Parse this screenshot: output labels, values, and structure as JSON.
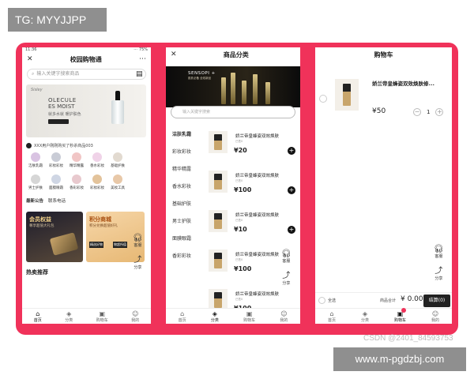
{
  "watermark_top": "TG: MYYJJPP",
  "watermark_bottom": "www.m-pgdzbj.com",
  "csdn_credit": "CSDN @2401_84593753",
  "colors": {
    "frame": "#f0325a",
    "dark": "#222222"
  },
  "screen1": {
    "status_time": "11:36",
    "status_right": "⋯ 75%",
    "title": "校园购物通",
    "close_icon": "close-icon",
    "more_icon": "more-icon",
    "search_placeholder": "输入关键字搜索商品",
    "banner": {
      "brand": "Sisley",
      "line1": "OLECULE",
      "line2": "ES MOIST",
      "line3": "就多水就 暖护肤色"
    },
    "notice": "XXX用户刚刚购买了秒杀商品003",
    "categories": [
      "洁肤乳霜",
      "彩妆彩妆",
      "精华精露",
      "香水彩妆",
      "基础护肤",
      "",
      "男士护肤",
      "面膜眼霜",
      "香彩彩妆",
      "彩妆彩妆",
      "美妆工具",
      ""
    ],
    "announce_label": "最新公告",
    "announce_text": "联系电话",
    "promo1_title": "会员权益",
    "promo1_sub": "尊享超值大礼包",
    "promo2_title": "积分商城",
    "promo2_sub": "积分兑换超值好礼",
    "promo2_tag1": "精选好物",
    "promo2_tag2": "物超所值",
    "hot_title": "热卖推荐",
    "float_service": "客服",
    "float_share": "分享",
    "tabs": [
      "首页",
      "分类",
      "购物车",
      "我的"
    ]
  },
  "screen2": {
    "title": "商品分类",
    "banner_title": "SENSOPI +",
    "banner_sub": "肌肤必备 全线新品",
    "search_placeholder": "输入关键字搜索",
    "side_items": [
      "洁肤乳霜",
      "彩妆彩妆",
      "精华精露",
      "香水彩妆",
      "基础护肤",
      "男士护肤",
      "面膜眼霜",
      "香彩彩妆"
    ],
    "products": [
      {
        "name": "娇兰帝皇蜂姿双效焕肤",
        "tag": "已售0",
        "price": "¥20"
      },
      {
        "name": "娇兰帝皇蜂姿双效焕肤",
        "tag": "已售0",
        "price": "¥100"
      },
      {
        "name": "娇兰帝皇蜂姿双效焕肤",
        "tag": "已售0",
        "price": "¥10"
      },
      {
        "name": "娇兰帝皇蜂姿双效焕肤",
        "tag": "已售0",
        "price": "¥100"
      },
      {
        "name": "娇兰帝皇蜂姿双效焕肤",
        "tag": "已售0",
        "price": "¥100"
      }
    ],
    "float_service": "客服",
    "float_share": "分享",
    "tabs": [
      "首页",
      "分类",
      "购物车",
      "我的"
    ]
  },
  "screen3": {
    "title": "购物车",
    "item_name": "娇兰帝皇蜂姿双效焕肤修...",
    "item_price": "¥50",
    "quantity": "1",
    "float_service": "客服",
    "float_share": "分享",
    "select_all": "全选",
    "total_label": "商品合计",
    "total_amount": "¥ 0.00",
    "checkout": "结算(0)",
    "tabs": [
      "首页",
      "分类",
      "购物车",
      "我的"
    ]
  }
}
